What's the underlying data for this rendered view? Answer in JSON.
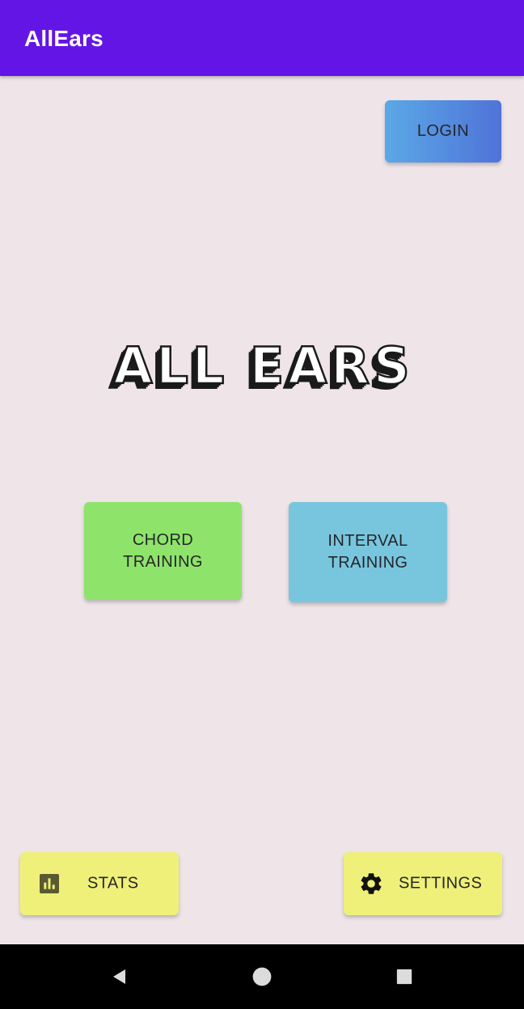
{
  "app_bar": {
    "title": "AllEars"
  },
  "login_label": "LOGIN",
  "logo": {
    "text": "ALL EARS"
  },
  "training": {
    "chord_label": "CHORD\nTRAINING",
    "interval_label": "INTERVAL\nTRAINING"
  },
  "bottom": {
    "stats_label": "STATS",
    "stats_icon": "bar-chart-icon",
    "settings_label": "SETTINGS",
    "settings_icon": "gear-icon"
  },
  "nav": {
    "back_icon": "back-triangle-icon",
    "home_icon": "home-circle-icon",
    "recents_icon": "recents-square-icon"
  },
  "colors": {
    "app_bar": "#6315e6",
    "background": "#efe5e9",
    "login": "#5b8fe0",
    "chord": "#8ee46a",
    "interval": "#78c6de",
    "bottom_buttons": "#eff079"
  }
}
